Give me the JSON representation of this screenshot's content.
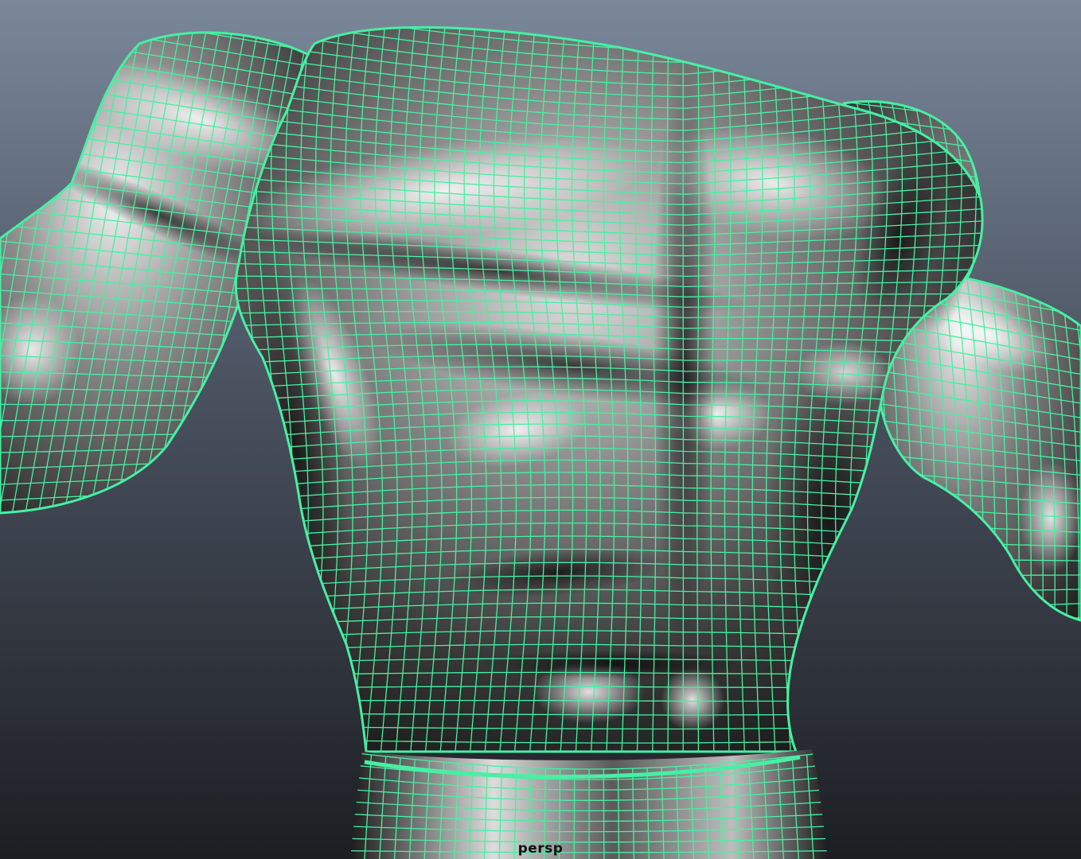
{
  "viewport": {
    "camera_label": "persp",
    "background_top": "#7a889a",
    "background_bottom": "#1c1e22",
    "wire_color": "#46f0a4",
    "shade_light": "#ececec",
    "shade_dark": "#1a1a1a",
    "object": "torso-mesh"
  }
}
